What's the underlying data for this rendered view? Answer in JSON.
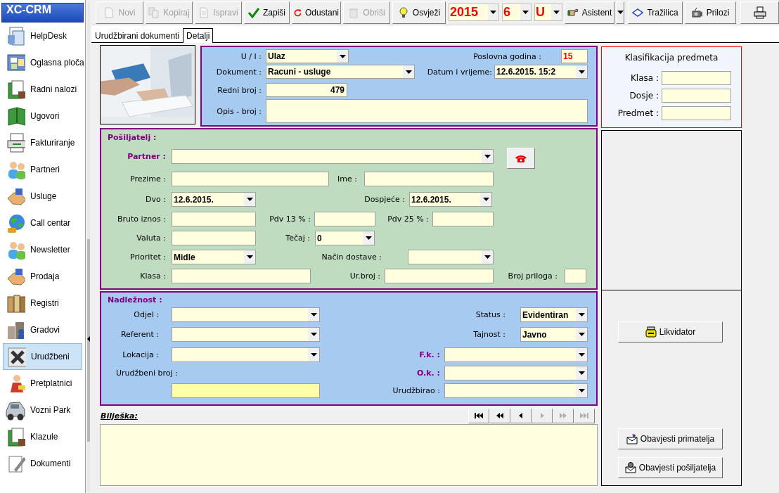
{
  "sidebar": {
    "title": "XC-CRM",
    "items": [
      {
        "label": "HelpDesk",
        "selected": false
      },
      {
        "label": "Oglasna ploča",
        "selected": false
      },
      {
        "label": "Radni nalozi",
        "selected": false
      },
      {
        "label": "Ugovori",
        "selected": false
      },
      {
        "label": "Fakturiranje",
        "selected": false
      },
      {
        "label": "Partneri",
        "selected": false
      },
      {
        "label": "Usluge",
        "selected": false
      },
      {
        "label": "Call centar",
        "selected": false
      },
      {
        "label": "Newsletter",
        "selected": false
      },
      {
        "label": "Prodaja",
        "selected": false
      },
      {
        "label": "Registri",
        "selected": false
      },
      {
        "label": "Gradovi",
        "selected": false
      },
      {
        "label": "Urudžbeni",
        "selected": true
      },
      {
        "label": "Pretplatnici",
        "selected": false
      },
      {
        "label": "Vozni Park",
        "selected": false
      },
      {
        "label": "Klazule",
        "selected": false
      },
      {
        "label": "Dokumenti",
        "selected": false
      }
    ]
  },
  "toolbar": {
    "buttons": [
      {
        "label": "Novi",
        "disabled": true
      },
      {
        "label": "Kopiraj",
        "disabled": true
      },
      {
        "label": "Ispravi",
        "disabled": true
      },
      {
        "label": "Zapiši",
        "disabled": false
      },
      {
        "label": "Odustani",
        "disabled": false
      },
      {
        "label": "Obriši",
        "disabled": true
      },
      {
        "label": "Osvježi",
        "disabled": false
      }
    ],
    "selectors": [
      {
        "value": "2015"
      },
      {
        "value": "6"
      },
      {
        "value": "U"
      }
    ],
    "actions": [
      {
        "label": "Asistent"
      },
      {
        "label": "Tražilica"
      },
      {
        "label": "Prilozi"
      }
    ]
  },
  "tabs": [
    {
      "label": "Urudžbirani dokumenti",
      "selected": false
    },
    {
      "label": "Detalji",
      "selected": true
    }
  ],
  "document_panel": {
    "rows": [
      [
        {
          "label": "U / I :",
          "required": false,
          "kind": "select",
          "value": "Ulaz"
        },
        {
          "label": "Poslovna godina :",
          "required": false,
          "kind": "text",
          "value": "15",
          "color": "#ff0000"
        }
      ],
      [
        {
          "label": "Dokument :",
          "required": false,
          "kind": "select",
          "value": "Racuni - usluge"
        },
        {
          "label": "Datum i vrijeme:",
          "required": false,
          "kind": "select",
          "value": "12.6.2015. 15:2"
        }
      ],
      [
        {
          "label": "Redni broj :",
          "required": false,
          "kind": "number",
          "value": "479"
        }
      ],
      [
        {
          "label": "Opis - broj :",
          "required": false,
          "kind": "area"
        }
      ]
    ]
  },
  "sender_panel": {
    "title": "Pošiljatelj  :",
    "rows": [
      [
        {
          "label": "Partner :",
          "required": true,
          "kind": "select"
        },
        {
          "kind": "phone"
        }
      ],
      [
        {
          "label": "Prezime :",
          "required": false,
          "kind": "text"
        },
        {
          "label": "Ime :",
          "required": false,
          "kind": "text"
        }
      ],
      [
        {
          "label": "Dvo :",
          "required": false,
          "kind": "select",
          "value": "12.6.2015."
        },
        {
          "label": "Dospjeće :",
          "required": false,
          "kind": "select",
          "value": "12.6.2015."
        }
      ],
      [
        {
          "label": "Bruto iznos :",
          "required": false,
          "kind": "text"
        },
        {
          "label": "Pdv 13 % :",
          "required": false,
          "kind": "text"
        },
        {
          "label": "Pdv 25 % :",
          "required": false,
          "kind": "text"
        }
      ],
      [
        {
          "label": "Valuta :",
          "required": false,
          "kind": "text"
        },
        {
          "label": "Tečaj :",
          "required": false,
          "kind": "select",
          "value": "0"
        }
      ],
      [
        {
          "label": "Prioritet :",
          "required": false,
          "kind": "select",
          "value": "Midle"
        },
        {
          "label": "Način dostave :",
          "required": false,
          "kind": "select"
        }
      ],
      [
        {
          "label": "Klasa :",
          "required": false,
          "kind": "text"
        },
        {
          "label": "Ur.broj :",
          "required": false,
          "kind": "text"
        },
        {
          "label": "Broj priloga :",
          "required": false,
          "kind": "text"
        }
      ]
    ]
  },
  "competence_panel": {
    "title": "Nadležnost  :",
    "rows": [
      [
        {
          "label": "Odjel :",
          "required": false,
          "kind": "select"
        },
        {
          "label": "Status :",
          "required": false,
          "kind": "select",
          "value": "Evidentiran"
        }
      ],
      [
        {
          "label": "Referent :",
          "required": false,
          "kind": "select"
        },
        {
          "label": "Tajnost :",
          "required": false,
          "kind": "select",
          "value": "Javno"
        }
      ],
      [
        {
          "label": "Lokacija :",
          "required": false,
          "kind": "select"
        },
        {
          "label": "F.k. :",
          "required": true,
          "kind": "select"
        }
      ],
      [
        {
          "label": "Urudžbeni broj :",
          "kind": "caption"
        },
        {
          "label": "O.k. :",
          "required": true,
          "kind": "select"
        }
      ],
      [
        {
          "kind": "key"
        },
        {
          "label": "Urudžbirao :",
          "required": false,
          "kind": "select"
        }
      ]
    ]
  },
  "notes": {
    "label": "Bilješka:",
    "navigation": [
      {
        "disabled": false
      },
      {
        "disabled": false
      },
      {
        "disabled": false
      },
      {
        "disabled": true
      },
      {
        "disabled": true
      },
      {
        "disabled": true
      }
    ]
  },
  "classification": {
    "title": "Klasifikacija predmeta",
    "fields": [
      {
        "label": "Klasa :"
      },
      {
        "label": "Dosje :"
      },
      {
        "label": "Predmet :"
      }
    ]
  },
  "actions": [
    {
      "label": "Likvidator"
    },
    {
      "label": "Obavjesti primatelja"
    },
    {
      "label": "Obavjesti pošiljatelja"
    }
  ]
}
